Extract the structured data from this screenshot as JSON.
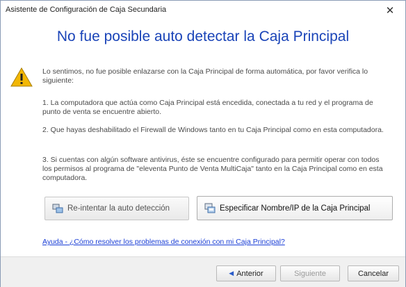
{
  "window": {
    "title": "Asistente de Configuración de Caja Secundaria",
    "close_glyph": "✕"
  },
  "heading": "No fue posible auto detectar la Caja Principal",
  "message": {
    "intro": "Lo sentimos, no fue posible enlazarse con la Caja Principal de forma automática, por favor verifica lo siguiente:",
    "item1": "1. La computadora que actúa como Caja Principal está encedida, conectada a tu red y el programa de punto de venta se encuentre abierto.",
    "item2": "2. Que hayas deshabilitado el Firewall de Windows tanto en tu Caja Principal como en esta computadora.",
    "item3": "3. Si cuentas con algún software antivirus, éste se encuentre configurado para permitir operar con todos los permisos al programa de \"eleventa Punto de Venta MultiCaja\" tanto en la Caja Principal como en esta computadora."
  },
  "actions": {
    "retry_label": "Re-intentar la auto detección",
    "specify_label": "Especificar Nombre/IP de la Caja Principal"
  },
  "help_link": "Ayuda - ¿Cómo resolver los problemas de conexión con mi Caja Principal?",
  "footer": {
    "prev_label": "Anterior",
    "next_label": "Siguiente",
    "cancel_label": "Cancelar"
  },
  "icons": {
    "warning": "warning-icon",
    "retry": "network-refresh-icon",
    "specify": "computer-network-icon"
  },
  "colors": {
    "heading": "#1a44b8",
    "warning": "#f2b705",
    "link": "#1a3ed6"
  }
}
